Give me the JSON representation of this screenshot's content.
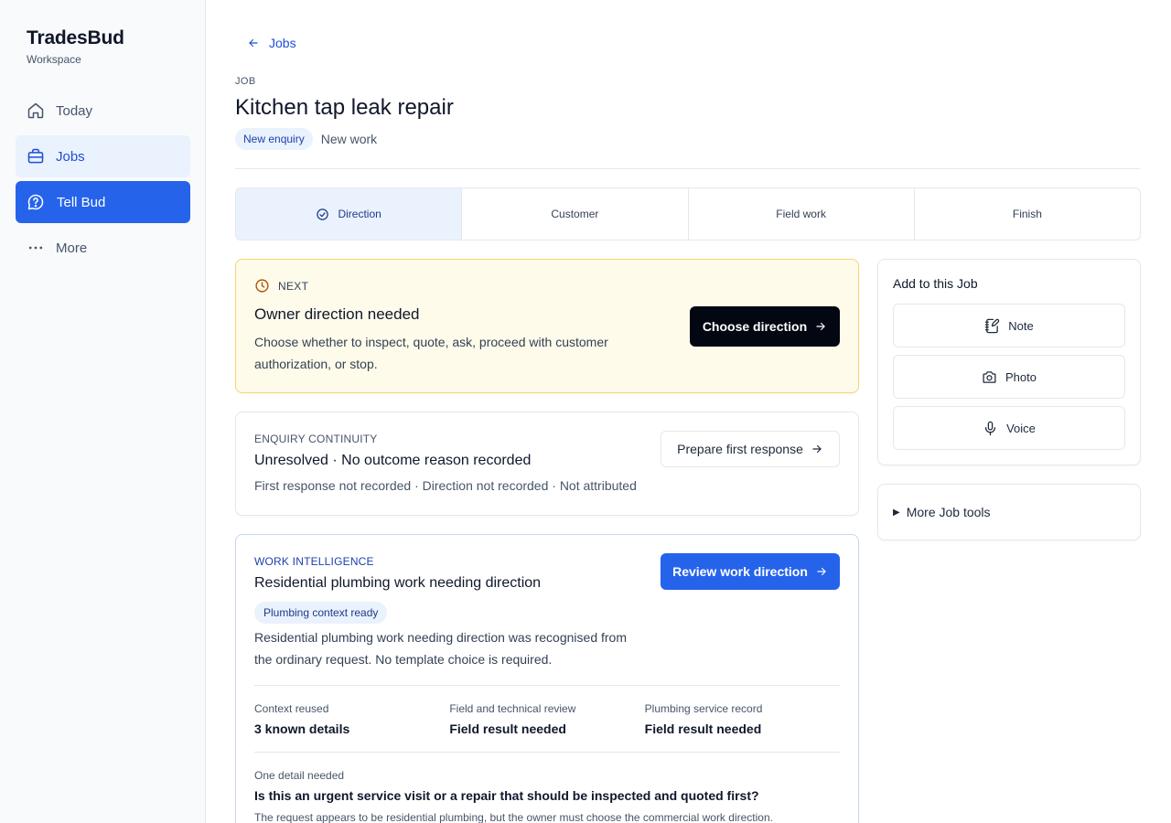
{
  "brand": {
    "title": "TradesBud",
    "subtitle": "Workspace"
  },
  "nav": {
    "today": "Today",
    "jobs": "Jobs",
    "tell_bud": "Tell Bud",
    "more": "More"
  },
  "header": {
    "back_label": "Jobs",
    "kicker": "JOB",
    "title": "Kitchen tap leak repair",
    "status_pill": "New enquiry",
    "status_text": "New work"
  },
  "steps": {
    "direction": "Direction",
    "customer": "Customer",
    "field_work": "Field work",
    "finish": "Finish"
  },
  "next_card": {
    "kicker": "NEXT",
    "title": "Owner direction needed",
    "description": "Choose whether to inspect, quote, ask, proceed with customer authorization, or stop.",
    "button": "Choose direction"
  },
  "enquiry_card": {
    "kicker": "ENQUIRY CONTINUITY",
    "title": "Unresolved · No outcome reason recorded",
    "meta": "First response not recorded · Direction not recorded · Not attributed",
    "button": "Prepare first response"
  },
  "work_card": {
    "kicker": "WORK INTELLIGENCE",
    "title": "Residential plumbing work needing direction",
    "pill": "Plumbing context ready",
    "description": "Residential plumbing work needing direction was recognised from the ordinary request. No template choice is required.",
    "button": "Review work direction",
    "facts": [
      {
        "label": "Context reused",
        "value": "3 known details"
      },
      {
        "label": "Field and technical review",
        "value": "Field result needed"
      },
      {
        "label": "Plumbing service record",
        "value": "Field result needed"
      }
    ],
    "detail_kicker": "One detail needed",
    "detail_question": "Is this an urgent service visit or a repair that should be inspected and quoted first?",
    "detail_note": "The request appears to be residential plumbing, but the owner must choose the commercial work direction."
  },
  "add_card": {
    "title": "Add to this Job",
    "note": "Note",
    "photo": "Photo",
    "voice": "Voice"
  },
  "tools_card": {
    "label": "More Job tools"
  },
  "colors": {
    "accent": "#2563eb",
    "accent_soft": "#eaf2fd",
    "next_bg": "#fefbea",
    "next_border": "#f5d76e",
    "dark_button": "#030712"
  },
  "icons": {
    "today": "home-icon",
    "jobs": "briefcase-icon",
    "tell_bud": "question-circle-icon",
    "more": "ellipsis-icon",
    "back": "arrow-left-icon",
    "direction_step": "check-circle-icon",
    "next": "clock-icon",
    "note": "notebook-pen-icon",
    "photo": "camera-icon",
    "voice": "microphone-icon",
    "button_arrow": "arrow-right-icon"
  }
}
